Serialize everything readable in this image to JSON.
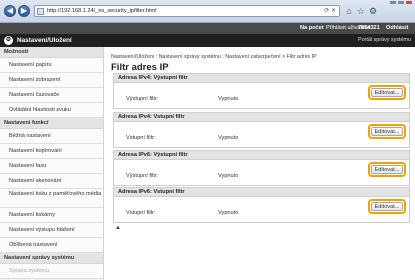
{
  "browser": {
    "url": "http://192.168.1.24/_ns_security_ipfilter.html",
    "back": "◀",
    "forward": "▶"
  },
  "topbar": {
    "remote": "Na počet",
    "user_label": "Přihlásit uživatele:",
    "user": "7654321",
    "logout": "Odhlásit"
  },
  "header": {
    "title": "Nastavení/Uložení",
    "portal": "Portál správy systému"
  },
  "sidebar": {
    "section1": "Možnosti",
    "items1": [
      "Nastavení papíru",
      "Nastavení zobrazení",
      "Nastavení časovače",
      "Ovládání hlasitosti zvuku"
    ],
    "section2": "Nastavení funkcí",
    "items2": [
      "Běžná nastavení",
      "Nastavení kopírování",
      "Nastavení faxu",
      "Nastavení skenování",
      "Nastavení tisku z paměťového média",
      "Nastavení tiskárny",
      "Nastavení výstupu hlášení",
      "Oblíbená nastavení"
    ],
    "section3": "Nastavení správy systému",
    "items3": [
      "Správa systému"
    ]
  },
  "main": {
    "breadcrumb": "Nastavení/Uložení : Nastavení správy systému : Nastavení zabezpečení > Filtr adres IP",
    "title": "Filtr adres IP",
    "panels": [
      {
        "title": "Adresa IPv4: Výstupní filtr",
        "label": "Výstupní filtr:",
        "value": "Vypnuto",
        "button": "Editovat..."
      },
      {
        "title": "Adresa IPv4: Vstupní filtr",
        "label": "Vstupní filtr:",
        "value": "Vypnuto",
        "button": "Editovat..."
      },
      {
        "title": "Adresa IPv6: Výstupní filtr",
        "label": "Výstupní filtr:",
        "value": "Vypnuto",
        "button": "Editovat..."
      },
      {
        "title": "Adresa IPv6: Vstupní filtr",
        "label": "Vstupní filtr:",
        "value": "Vypnuto",
        "button": "Editovat..."
      }
    ],
    "top_link": "▲"
  },
  "colors": {
    "highlight": "#f0a300",
    "header": "#202020",
    "topbar": "#4a4a4a"
  }
}
